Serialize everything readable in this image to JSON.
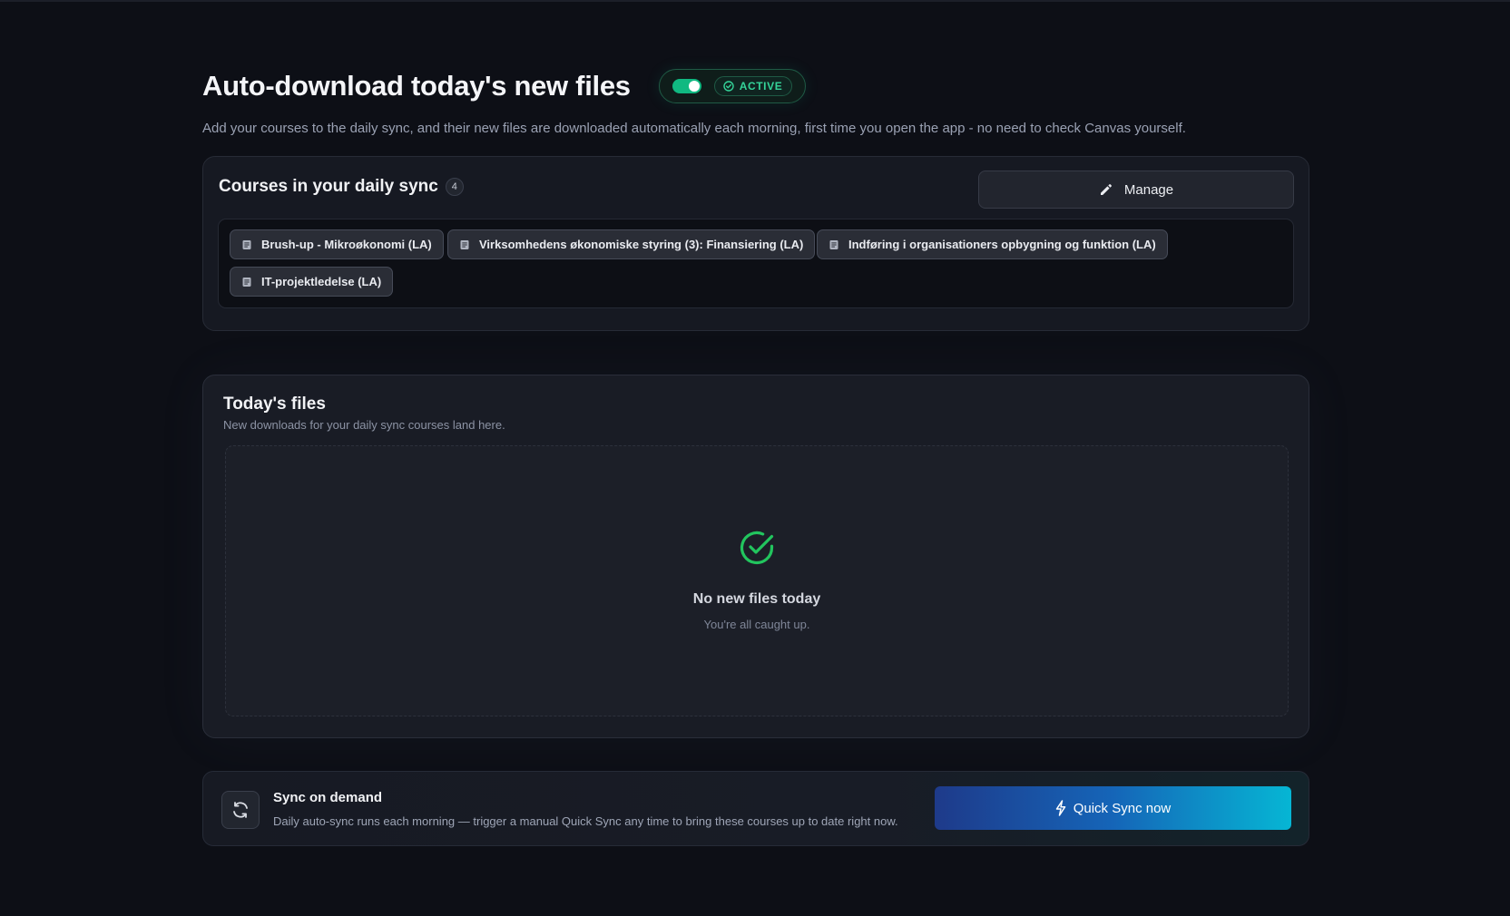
{
  "header": {
    "title": "Auto-download today's new files",
    "status_label": "ACTIVE",
    "subtitle": "Add your courses to the daily sync, and their new files are downloaded automatically each morning, first time you open the app - no need to check Canvas yourself."
  },
  "courses": {
    "title": "Courses in your daily sync",
    "count": "4",
    "manage_label": "Manage",
    "items": [
      {
        "label": "Brush-up - Mikroøkonomi (LA)"
      },
      {
        "label": "Virksomhedens økonomiske styring (3): Finansiering (LA)"
      },
      {
        "label": "Indføring i organisationers opbygning og funktion (LA)"
      },
      {
        "label": "IT-projektledelse (LA)"
      }
    ]
  },
  "files": {
    "title": "Today's files",
    "subtitle": "New downloads for your daily sync courses land here.",
    "empty_title": "No new files today",
    "empty_subtitle": "You're all caught up."
  },
  "sync": {
    "title": "Sync on demand",
    "description": "Daily auto-sync runs each morning — trigger a manual Quick Sync any time to bring these courses up to date right now.",
    "button_label": "Quick Sync now"
  },
  "colors": {
    "accent_green": "#10b981",
    "button_gradient_start": "#1e3a8a",
    "button_gradient_end": "#06b6d4"
  }
}
